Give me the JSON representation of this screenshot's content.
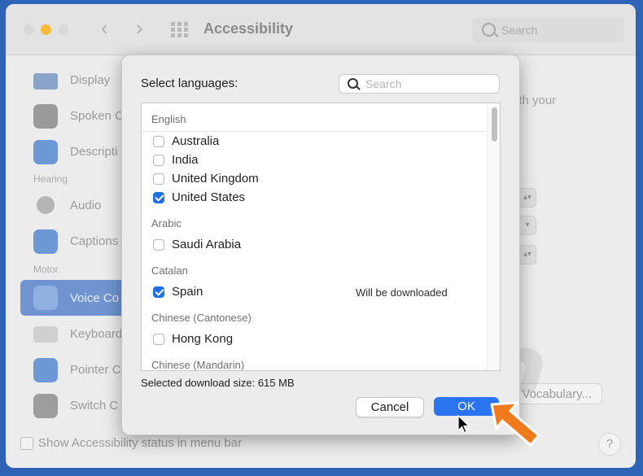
{
  "window": {
    "title": "Accessibility",
    "search_placeholder": "Search",
    "bottom_checkbox_label": "Show Accessibility status in menu bar",
    "help_label": "?",
    "right_fragment": "ith your",
    "vocabulary_button": "Vocabulary..."
  },
  "sidebar": {
    "items": [
      {
        "label": "Display",
        "icon": "display-icon"
      },
      {
        "label": "Spoken C",
        "icon": "spoken-content-icon"
      },
      {
        "label": "Descripti",
        "icon": "descriptions-icon"
      },
      {
        "label": "Audio",
        "icon": "audio-icon"
      },
      {
        "label": "Captions",
        "icon": "captions-icon"
      },
      {
        "label": "Voice Co",
        "icon": "voice-control-icon"
      },
      {
        "label": "Keyboard",
        "icon": "keyboard-icon"
      },
      {
        "label": "Pointer C",
        "icon": "pointer-control-icon"
      },
      {
        "label": "Switch C",
        "icon": "switch-control-icon"
      }
    ],
    "headers": {
      "hearing": "Hearing",
      "motor": "Motor"
    }
  },
  "sheet": {
    "title": "Select languages:",
    "search_placeholder": "Search",
    "groups": [
      {
        "name": "English",
        "items": [
          {
            "label": "Australia",
            "checked": false,
            "note": ""
          },
          {
            "label": "India",
            "checked": false,
            "note": ""
          },
          {
            "label": "United Kingdom",
            "checked": false,
            "note": ""
          },
          {
            "label": "United States",
            "checked": true,
            "note": ""
          }
        ]
      },
      {
        "name": "Arabic",
        "items": [
          {
            "label": "Saudi Arabia",
            "checked": false,
            "note": ""
          }
        ]
      },
      {
        "name": "Catalan",
        "items": [
          {
            "label": "Spain",
            "checked": true,
            "note": "Will be downloaded"
          }
        ]
      },
      {
        "name": "Chinese (Cantonese)",
        "items": [
          {
            "label": "Hong Kong",
            "checked": false,
            "note": ""
          }
        ]
      },
      {
        "name": "Chinese (Mandarin)",
        "items": []
      }
    ],
    "download_size": "Selected download size: 615 MB",
    "cancel_label": "Cancel",
    "ok_label": "OK"
  },
  "watermark": {
    "text": "PCrisk.com"
  },
  "colors": {
    "accent": "#2b74f1",
    "checkbox_on": "#1f6fe8",
    "arrow": "#f07b1c",
    "desktop": "#2f63b5"
  }
}
